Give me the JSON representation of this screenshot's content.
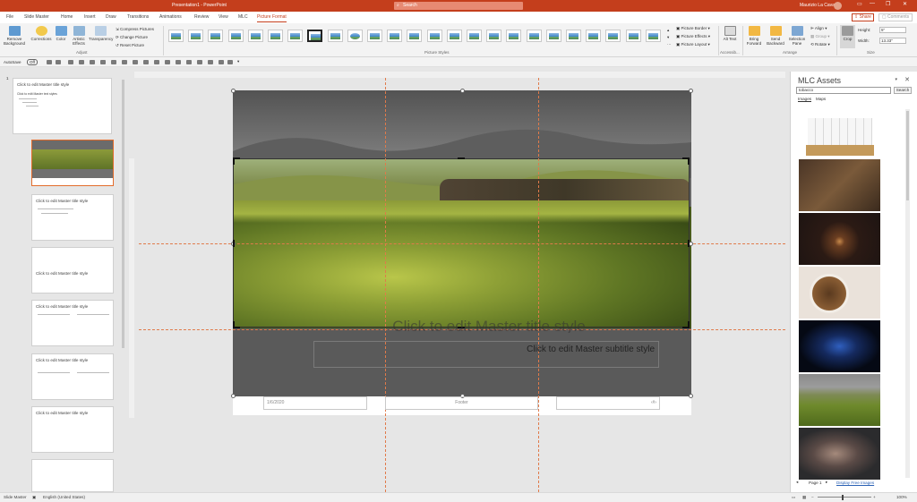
{
  "title_bar": {
    "document": "Presentation1 - PowerPoint",
    "search_placeholder": "Search",
    "user": "Maurizio La Cava",
    "minimize": "—",
    "restore": "❐",
    "close": "✕"
  },
  "tabs": [
    "File",
    "Slide Master",
    "Home",
    "Insert",
    "Draw",
    "Transitions",
    "Animations",
    "Review",
    "View",
    "MLC",
    "Picture Format"
  ],
  "active_tab": "Picture Format",
  "share_label": "Share",
  "comments_label": "Comments",
  "ribbon": {
    "remove_bg": "Remove Background",
    "corrections": "Corrections",
    "color": "Color",
    "artistic": "Artistic Effects",
    "transparency": "Transparency",
    "compress": "Compress Pictures",
    "change": "Change Picture",
    "reset": "Reset Picture",
    "adjust_group": "Adjust",
    "styles_group": "Picture Styles",
    "border": "Picture Border",
    "effects": "Picture Effects",
    "layout": "Picture Layout",
    "alt_text": "Alt Text",
    "access_group": "Accessib...",
    "bring_forward": "Bring Forward",
    "send_backward": "Send Backward",
    "selection_pane": "Selection Pane",
    "align": "Align",
    "group": "Group",
    "rotate": "Rotate",
    "arrange_group": "Arrange",
    "crop": "Crop",
    "height_label": "Height:",
    "height_value": "5\"",
    "width_label": "Width:",
    "width_value": "13.33\"",
    "size_group": "Size"
  },
  "qat": {
    "autosave": "AutoSave",
    "off": "Off"
  },
  "thumbnails": {
    "master_title": "Click to edit Master title style",
    "master_text": "Click to edit Master text styles",
    "layout_title": "Click to edit Master title style",
    "slide_num": "1"
  },
  "slide": {
    "title_placeholder": "Click to edit Master title style",
    "subtitle_placeholder": "Click to edit Master subtitle style",
    "date": "1/6/2020",
    "footer": "Footer",
    "page_num": "‹#›"
  },
  "mlc_panel": {
    "title": "MLC Assets",
    "search_value": "tobacco",
    "search_button": "Search",
    "tab_images": "Images",
    "tab_maps": "Maps",
    "page_label": "Page 1",
    "license_link": "Display Free Images"
  },
  "status_bar": {
    "view": "Slide Master",
    "language": "English (United States)",
    "zoom": "100%"
  }
}
